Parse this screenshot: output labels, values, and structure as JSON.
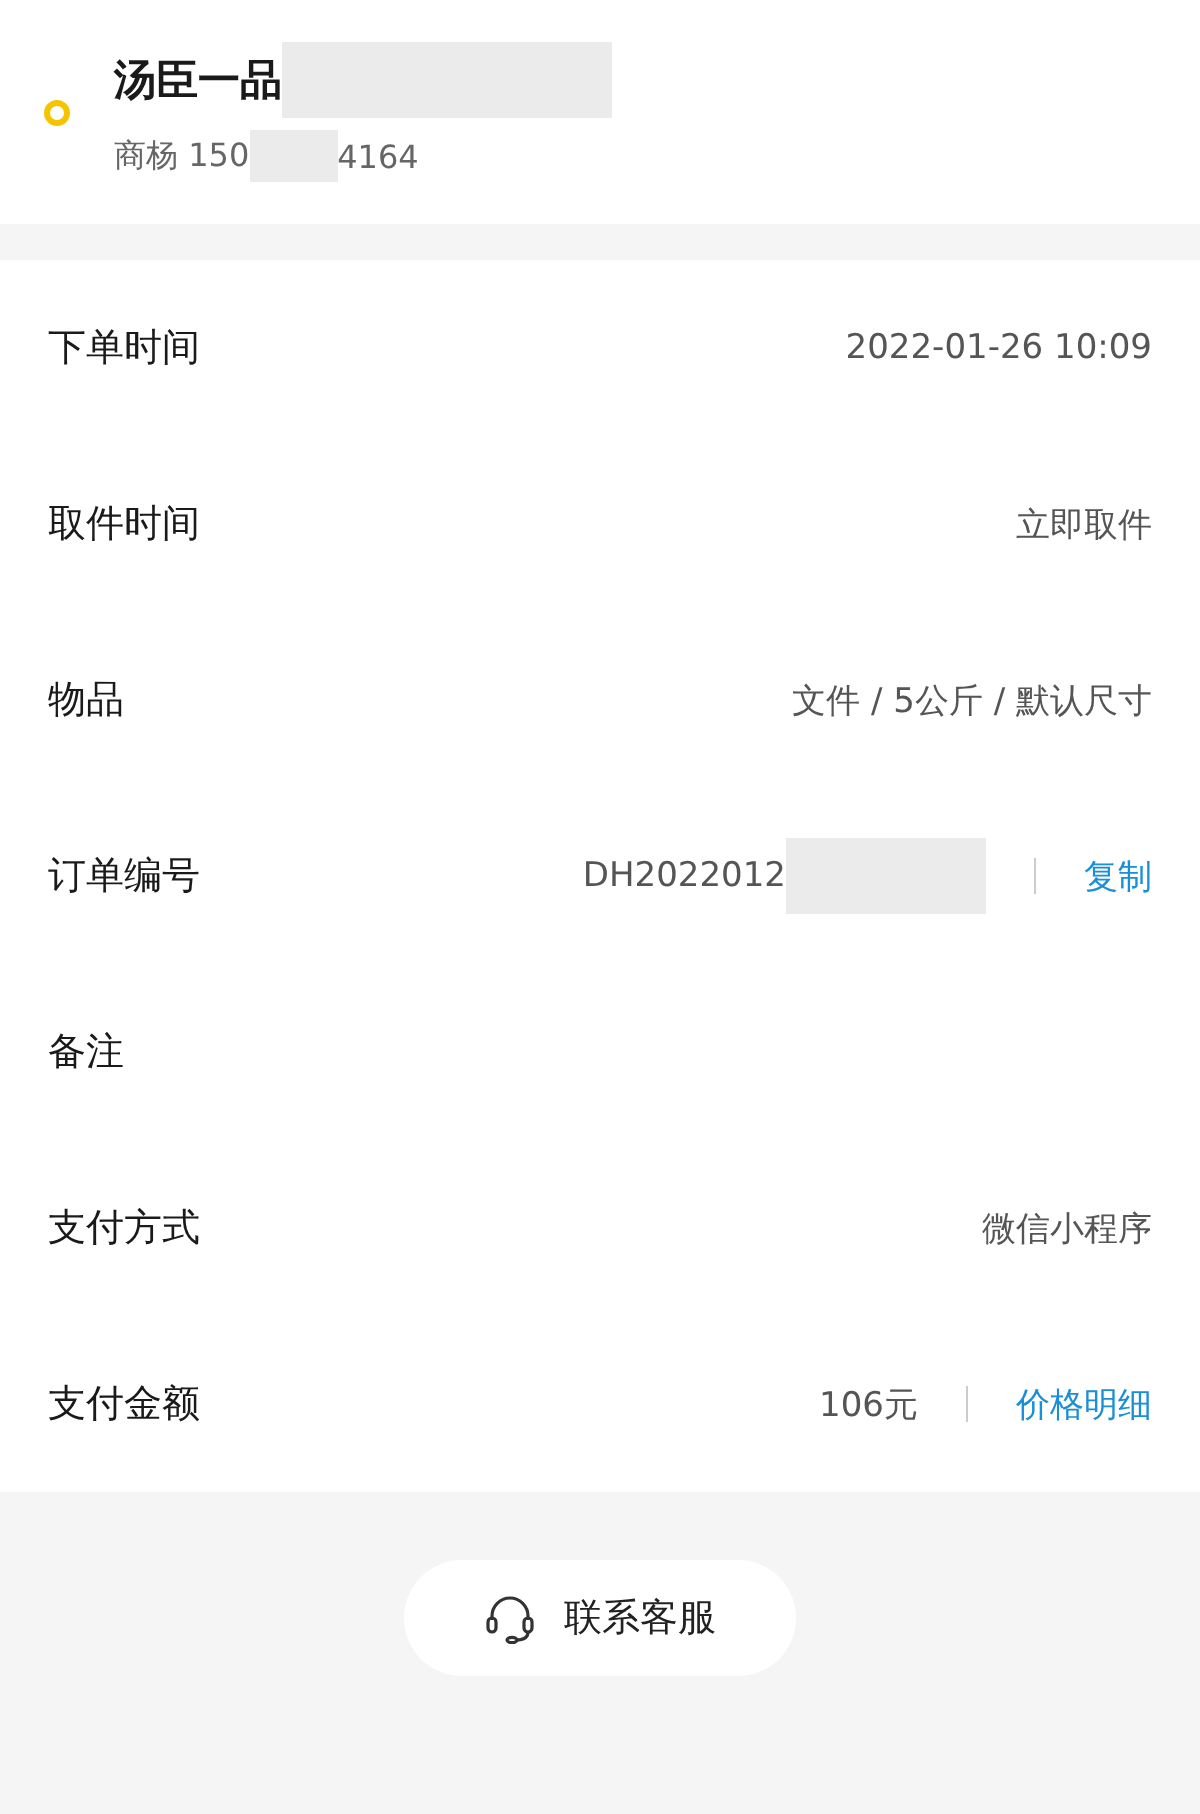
{
  "address": {
    "name": "汤臣一品",
    "contact_start": "商杨 150",
    "contact_end": "4164"
  },
  "rows": [
    {
      "label": "下单时间",
      "value": "2022-01-26 10:09"
    },
    {
      "label": "取件时间",
      "value": "立即取件"
    },
    {
      "label": "物品",
      "value": "文件 / 5公斤 / 默认尺寸"
    },
    {
      "label": "订单编号",
      "value": "DH2022012",
      "redacted": true,
      "link": "复制"
    },
    {
      "label": "备注"
    },
    {
      "label": "支付方式",
      "value": "微信小程序"
    },
    {
      "label": "支付金额",
      "value": "106元",
      "link": "价格明细"
    }
  ],
  "support_button": "联系客服"
}
